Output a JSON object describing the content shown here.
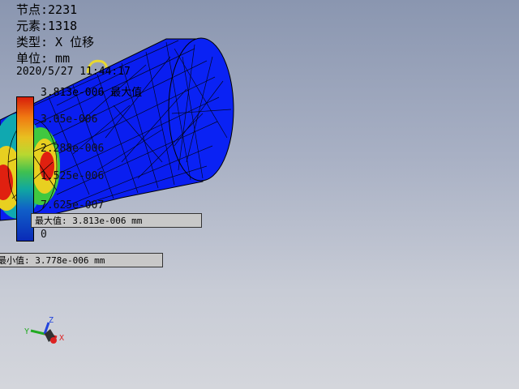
{
  "info": {
    "nodes": "节点:2231",
    "elements": "元素:1318",
    "type": "类型: X 位移",
    "unit": "单位: mm"
  },
  "datetime": "2020/5/27 11:44:17",
  "legend": {
    "max_header": "3.813e-006 最大值",
    "ticks": [
      "3.05e-006",
      "2.288e-006",
      "1.525e-006",
      "7.625e-007",
      "0"
    ]
  },
  "callouts": {
    "max": "最大值: 3.813e-006 mm",
    "min": "最小值: 3.778e-006 mm"
  },
  "axes": {
    "x": "X",
    "y": "Y",
    "z": "Z"
  },
  "colors": {
    "mesh_blue": "#0a1ef0",
    "hot_red": "#e02010",
    "background_top": "#8a96b0",
    "background_bottom": "#d4d6dc"
  }
}
